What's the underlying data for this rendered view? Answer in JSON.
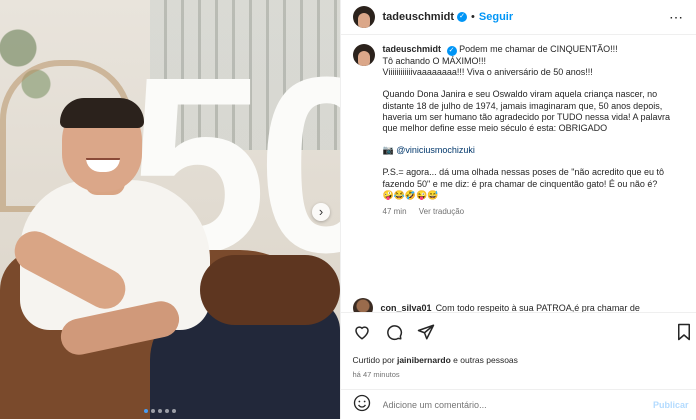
{
  "post": {
    "username": "tadeuschmidt",
    "follow_label": "Seguir",
    "more_icon": "⋯",
    "next_icon": "›",
    "big_number": "50",
    "carousel": {
      "slides": 5,
      "active": 0
    }
  },
  "caption": {
    "lines": [
      "Podem me chamar de CINQUENTÃO!!!",
      "Tô achando O MÁXIMO!!!",
      "Viiiiiiiiiiiivaaaaaaaa!!! Viva o aniversário de 50 anos!!!"
    ],
    "paragraph2": "Quando Dona Janira e seu Oswaldo viram aquela criança nascer, no distante 18 de julho de 1974, jamais imaginaram que, 50 anos depois, haveria um ser humano tão agradecido por TUDO nessa vida! A palavra que melhor define esse meio século é esta: OBRIGADO",
    "credit_emoji": "📷",
    "credit": "@viniciusmochizuki",
    "paragraph4": "P.S.= agora... dá uma olhada nessas poses de \"não acredito que eu tô fazendo 50\" e me diz: é pra chamar de cinquentão gato! É ou não é?",
    "emojis": "🤪😂🤣😜😅",
    "time": "47 min",
    "translate": "Ver tradução"
  },
  "comment": {
    "username": "con_silva01",
    "text": "Com todo respeito à sua PATROA,é pra chamar de"
  },
  "actions": {
    "likes_prefix": "Curtido por",
    "likes_user": "jainibernardo",
    "likes_suffix": "e outras pessoas",
    "time_ago": "há 47 minutos"
  },
  "add_comment": {
    "placeholder": "Adicione um comentário...",
    "publish_label": "Publicar"
  },
  "colors": {
    "accent": "#0095f6",
    "link": "#00376b",
    "muted": "#737373"
  },
  "icons": [
    "heart-icon",
    "comment-icon",
    "share-icon",
    "bookmark-icon",
    "emoji-icon",
    "verified-icon",
    "camera-icon"
  ]
}
